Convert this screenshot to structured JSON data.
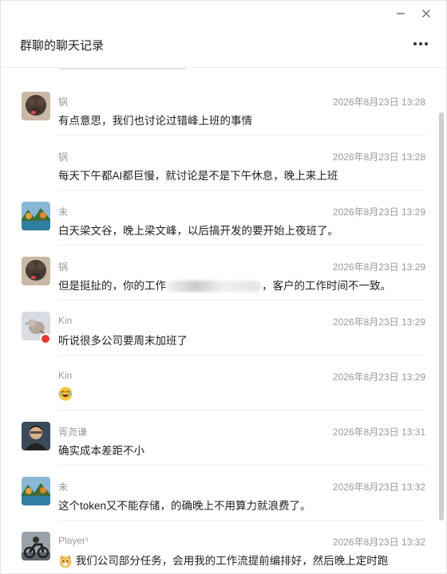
{
  "window": {
    "title": "群聊的聊天记录",
    "controls": {
      "minimize_icon": "minimize-icon",
      "close_icon": "close-icon",
      "more_icon": "more-icon"
    }
  },
  "colors": {
    "meta_text": "#9a9a9a",
    "body_text": "#1f1f1f",
    "separator": "#efefef"
  },
  "messages": [
    {
      "name": "锅",
      "time": "2026年8月23日 13:28",
      "text": "有点意思，我们也讨论过错峰上班的事情",
      "avatar": "dog-avatar"
    },
    {
      "name": "锅",
      "time": "2026年8月23日 13:28",
      "text": "每天下午都AI都巨慢，就讨论是不是下午休息，晚上来上班",
      "avatar": ""
    },
    {
      "name": "未",
      "time": "2026年8月23日 13:29",
      "text": "白天梁文谷，晚上梁文峰，以后搞开发的要开始上夜班了。",
      "avatar": "landscape-avatar"
    },
    {
      "name": "锅",
      "time": "2026年8月23日 13:29",
      "text_before": "但是挺扯的，你的工作",
      "text_after": "，客户的工作时间不一致。",
      "avatar": "dog-avatar"
    },
    {
      "name": "Kin",
      "time": "2026年8月23日 13:29",
      "text": "听说很多公司要周末加班了",
      "avatar": "bird-avatar"
    },
    {
      "name": "Kin",
      "time": "2026年8月23日 13:29",
      "text": "",
      "emoji": "laughing-emoji",
      "avatar": ""
    },
    {
      "name": "胥尧谦",
      "time": "2026年8月23日 13:31",
      "text": "确实成本差距不小",
      "avatar": "person-avatar"
    },
    {
      "name": "未",
      "time": "2026年8月23日 13:32",
      "text": "这个token又不能存储，的确晚上不用算力就浪费了。",
      "avatar": "landscape-avatar"
    },
    {
      "name": "Player¹",
      "time": "2026年8月23日 13:32",
      "text": "我们公司部分任务，会用我的工作流提前编排好，然后晚上定时跑",
      "emoji": "dog-emoji",
      "avatar": "motorbike-avatar"
    }
  ]
}
